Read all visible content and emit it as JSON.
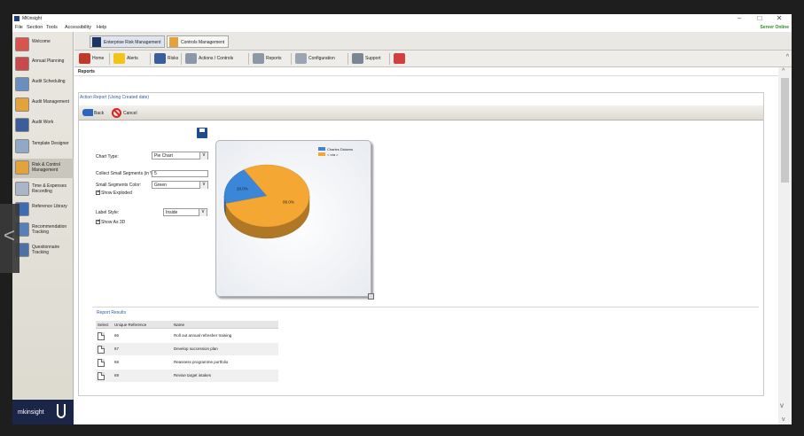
{
  "window": {
    "title": "MKinsight",
    "minimize_glyph": "–",
    "maximize_glyph": "□",
    "close_glyph": "✕",
    "server_status": "Server Online",
    "server_status_color": "#2e8b2e"
  },
  "menu": [
    "File",
    "Section",
    "Tools",
    "Accessibility",
    "Help"
  ],
  "sidebar": {
    "items": [
      {
        "label": "Welcome",
        "icon": "welcome-icon",
        "color": "#d9534f"
      },
      {
        "label": "Annual Planning",
        "icon": "calendar-icon",
        "color": "#c94a4a"
      },
      {
        "label": "Audit Scheduling",
        "icon": "schedule-icon",
        "color": "#6a8fbf"
      },
      {
        "label": "Audit Management",
        "icon": "folder-icon",
        "color": "#e4a33a"
      },
      {
        "label": "Audit Work",
        "icon": "binder-icon",
        "color": "#3a5e9b"
      },
      {
        "label": "Template Designer",
        "icon": "pencil-icon",
        "color": "#8fa9c7"
      },
      {
        "label": "Risk & Control Management",
        "icon": "binder-risk-icon",
        "color": "#e4a33a"
      },
      {
        "label": "Time & Expenses Recording",
        "icon": "clock-icon",
        "color": "#aab6c8"
      },
      {
        "label": "Reference Library",
        "icon": "books-icon",
        "color": "#3b6db5"
      },
      {
        "label": "Recommendation Tracking",
        "icon": "magnifier-icon",
        "color": "#5580b8"
      },
      {
        "label": "Questionnaire Tracking",
        "icon": "questionnaire-icon",
        "color": "#4a72a8"
      }
    ],
    "logo_text": "mkinsight"
  },
  "topnav": {
    "tabs": [
      {
        "label": "Enterprise Risk Management",
        "icon": "binder-icon"
      },
      {
        "label": "Controls Management",
        "icon": "folder-icon"
      }
    ]
  },
  "toolbar": {
    "items": [
      {
        "label": "Home",
        "icon": "home-icon",
        "color": "#c0392b"
      },
      {
        "label": "Alerts",
        "icon": "warning-icon",
        "color": "#f0c419"
      },
      {
        "label": "Risks",
        "icon": "risk-binder-icon",
        "color": "#3a5e9b"
      },
      {
        "label": "Actions / Controls",
        "icon": "gears-icon",
        "color": "#8c98a8"
      },
      {
        "label": "Reports",
        "icon": "reports-icon",
        "color": "#8c98a8"
      },
      {
        "label": "Configuration",
        "icon": "tools-icon",
        "color": "#9aa4b2"
      },
      {
        "label": "Support",
        "icon": "support-icon",
        "color": "#7a8596"
      },
      {
        "label": "",
        "icon": "exit-icon",
        "color": "#d04040"
      }
    ]
  },
  "page": {
    "section": "Reports",
    "report_title": "Action Report (Using Created date)",
    "back_label": "Back",
    "cancel_label": "Cancel"
  },
  "form": {
    "chart_type_label": "Chart Type:",
    "chart_type_value": "Pie Chart",
    "collect_small_label": "Collect Small Segments (in %):",
    "collect_small_value": "5",
    "small_color_label": "Small Segments Color:",
    "small_color_value": "Green",
    "show_exploded_label": "Show Exploded",
    "label_style_label": "Label Style:",
    "label_style_value": "Inside",
    "show_3d_label": "Show As 3D"
  },
  "chart_data": {
    "type": "pie",
    "slices": [
      {
        "label": "Charles Dickens",
        "value": 20.0,
        "color": "#3a86d8"
      },
      {
        "label": "< n/a >",
        "value": 80.0,
        "color": "#f5a733"
      }
    ],
    "data_labels": [
      "20.0%",
      "80.0%"
    ],
    "legend_position": "top-right",
    "three_d": true
  },
  "results": {
    "title": "Report Results",
    "columns": [
      "Select",
      "Unique Reference",
      "Name"
    ],
    "rows": [
      {
        "ref": "66",
        "name": "Roll out annual refresher training"
      },
      {
        "ref": "67",
        "name": "Develop succession plan"
      },
      {
        "ref": "68",
        "name": "Reassess programme portfolio"
      },
      {
        "ref": "69",
        "name": "Revise target intakes"
      }
    ]
  }
}
